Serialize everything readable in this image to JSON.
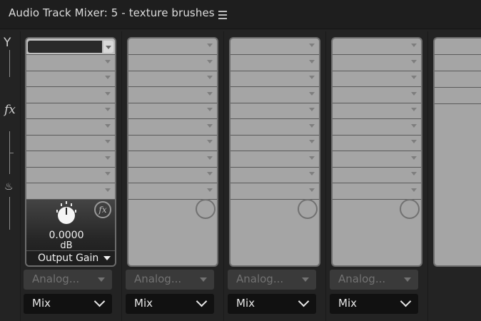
{
  "window": {
    "title": "Audio Track Mixer: 5 - texture brushes"
  },
  "left_rail": {
    "icons": [
      "input-y-icon",
      "fx-icon",
      "send-icon"
    ]
  },
  "channels": [
    {
      "id": 1,
      "insert_slots": 10,
      "output_gain": {
        "value": "0.0000",
        "unit": "dB",
        "label": "Output Gain"
      },
      "input": "Analog...",
      "mode": "Mix"
    },
    {
      "id": 2,
      "insert_slots": 10,
      "input": "Analog...",
      "mode": "Mix"
    },
    {
      "id": 3,
      "insert_slots": 10,
      "input": "Analog...",
      "mode": "Mix"
    },
    {
      "id": 4,
      "insert_slots": 10,
      "input": "Analog...",
      "mode": "Mix"
    }
  ],
  "colors": {
    "panel": "#a5a5a5",
    "background": "#232323",
    "header": "#1e1e1e"
  }
}
